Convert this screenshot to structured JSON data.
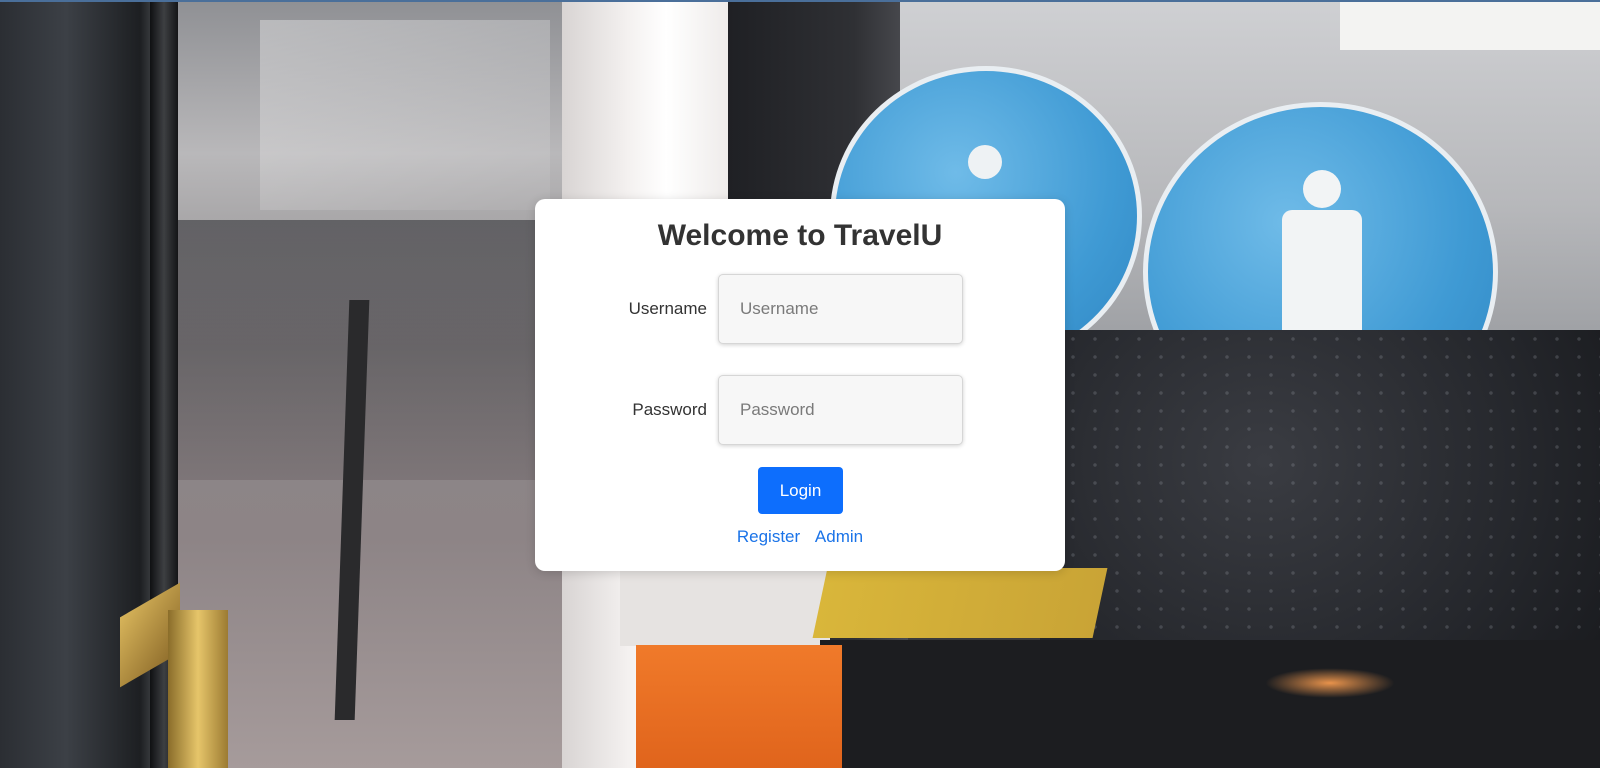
{
  "login": {
    "title": "Welcome to TravelU",
    "username_label": "Username",
    "username_placeholder": "Username",
    "password_label": "Password",
    "password_placeholder": "Password",
    "login_button": "Login",
    "register_link": "Register",
    "admin_link": "Admin"
  },
  "colors": {
    "primary_button": "#0d6efd",
    "link": "#1a73e8",
    "card_background": "#ffffff",
    "input_background": "#f7f7f7"
  },
  "icons": {
    "background": "bus-window-photo"
  }
}
